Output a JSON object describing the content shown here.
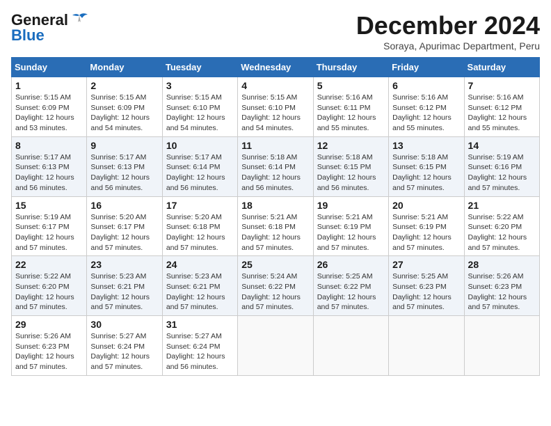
{
  "logo": {
    "general": "General",
    "blue": "Blue"
  },
  "header": {
    "month_title": "December 2024",
    "subtitle": "Soraya, Apurimac Department, Peru"
  },
  "weekdays": [
    "Sunday",
    "Monday",
    "Tuesday",
    "Wednesday",
    "Thursday",
    "Friday",
    "Saturday"
  ],
  "weeks": [
    [
      {
        "day": "1",
        "sunrise": "5:15 AM",
        "sunset": "6:09 PM",
        "daylight": "12 hours and 53 minutes."
      },
      {
        "day": "2",
        "sunrise": "5:15 AM",
        "sunset": "6:09 PM",
        "daylight": "12 hours and 54 minutes."
      },
      {
        "day": "3",
        "sunrise": "5:15 AM",
        "sunset": "6:10 PM",
        "daylight": "12 hours and 54 minutes."
      },
      {
        "day": "4",
        "sunrise": "5:15 AM",
        "sunset": "6:10 PM",
        "daylight": "12 hours and 54 minutes."
      },
      {
        "day": "5",
        "sunrise": "5:16 AM",
        "sunset": "6:11 PM",
        "daylight": "12 hours and 55 minutes."
      },
      {
        "day": "6",
        "sunrise": "5:16 AM",
        "sunset": "6:12 PM",
        "daylight": "12 hours and 55 minutes."
      },
      {
        "day": "7",
        "sunrise": "5:16 AM",
        "sunset": "6:12 PM",
        "daylight": "12 hours and 55 minutes."
      }
    ],
    [
      {
        "day": "8",
        "sunrise": "5:17 AM",
        "sunset": "6:13 PM",
        "daylight": "12 hours and 56 minutes."
      },
      {
        "day": "9",
        "sunrise": "5:17 AM",
        "sunset": "6:13 PM",
        "daylight": "12 hours and 56 minutes."
      },
      {
        "day": "10",
        "sunrise": "5:17 AM",
        "sunset": "6:14 PM",
        "daylight": "12 hours and 56 minutes."
      },
      {
        "day": "11",
        "sunrise": "5:18 AM",
        "sunset": "6:14 PM",
        "daylight": "12 hours and 56 minutes."
      },
      {
        "day": "12",
        "sunrise": "5:18 AM",
        "sunset": "6:15 PM",
        "daylight": "12 hours and 56 minutes."
      },
      {
        "day": "13",
        "sunrise": "5:18 AM",
        "sunset": "6:15 PM",
        "daylight": "12 hours and 57 minutes."
      },
      {
        "day": "14",
        "sunrise": "5:19 AM",
        "sunset": "6:16 PM",
        "daylight": "12 hours and 57 minutes."
      }
    ],
    [
      {
        "day": "15",
        "sunrise": "5:19 AM",
        "sunset": "6:17 PM",
        "daylight": "12 hours and 57 minutes."
      },
      {
        "day": "16",
        "sunrise": "5:20 AM",
        "sunset": "6:17 PM",
        "daylight": "12 hours and 57 minutes."
      },
      {
        "day": "17",
        "sunrise": "5:20 AM",
        "sunset": "6:18 PM",
        "daylight": "12 hours and 57 minutes."
      },
      {
        "day": "18",
        "sunrise": "5:21 AM",
        "sunset": "6:18 PM",
        "daylight": "12 hours and 57 minutes."
      },
      {
        "day": "19",
        "sunrise": "5:21 AM",
        "sunset": "6:19 PM",
        "daylight": "12 hours and 57 minutes."
      },
      {
        "day": "20",
        "sunrise": "5:21 AM",
        "sunset": "6:19 PM",
        "daylight": "12 hours and 57 minutes."
      },
      {
        "day": "21",
        "sunrise": "5:22 AM",
        "sunset": "6:20 PM",
        "daylight": "12 hours and 57 minutes."
      }
    ],
    [
      {
        "day": "22",
        "sunrise": "5:22 AM",
        "sunset": "6:20 PM",
        "daylight": "12 hours and 57 minutes."
      },
      {
        "day": "23",
        "sunrise": "5:23 AM",
        "sunset": "6:21 PM",
        "daylight": "12 hours and 57 minutes."
      },
      {
        "day": "24",
        "sunrise": "5:23 AM",
        "sunset": "6:21 PM",
        "daylight": "12 hours and 57 minutes."
      },
      {
        "day": "25",
        "sunrise": "5:24 AM",
        "sunset": "6:22 PM",
        "daylight": "12 hours and 57 minutes."
      },
      {
        "day": "26",
        "sunrise": "5:25 AM",
        "sunset": "6:22 PM",
        "daylight": "12 hours and 57 minutes."
      },
      {
        "day": "27",
        "sunrise": "5:25 AM",
        "sunset": "6:23 PM",
        "daylight": "12 hours and 57 minutes."
      },
      {
        "day": "28",
        "sunrise": "5:26 AM",
        "sunset": "6:23 PM",
        "daylight": "12 hours and 57 minutes."
      }
    ],
    [
      {
        "day": "29",
        "sunrise": "5:26 AM",
        "sunset": "6:23 PM",
        "daylight": "12 hours and 57 minutes."
      },
      {
        "day": "30",
        "sunrise": "5:27 AM",
        "sunset": "6:24 PM",
        "daylight": "12 hours and 57 minutes."
      },
      {
        "day": "31",
        "sunrise": "5:27 AM",
        "sunset": "6:24 PM",
        "daylight": "12 hours and 56 minutes."
      },
      null,
      null,
      null,
      null
    ]
  ]
}
